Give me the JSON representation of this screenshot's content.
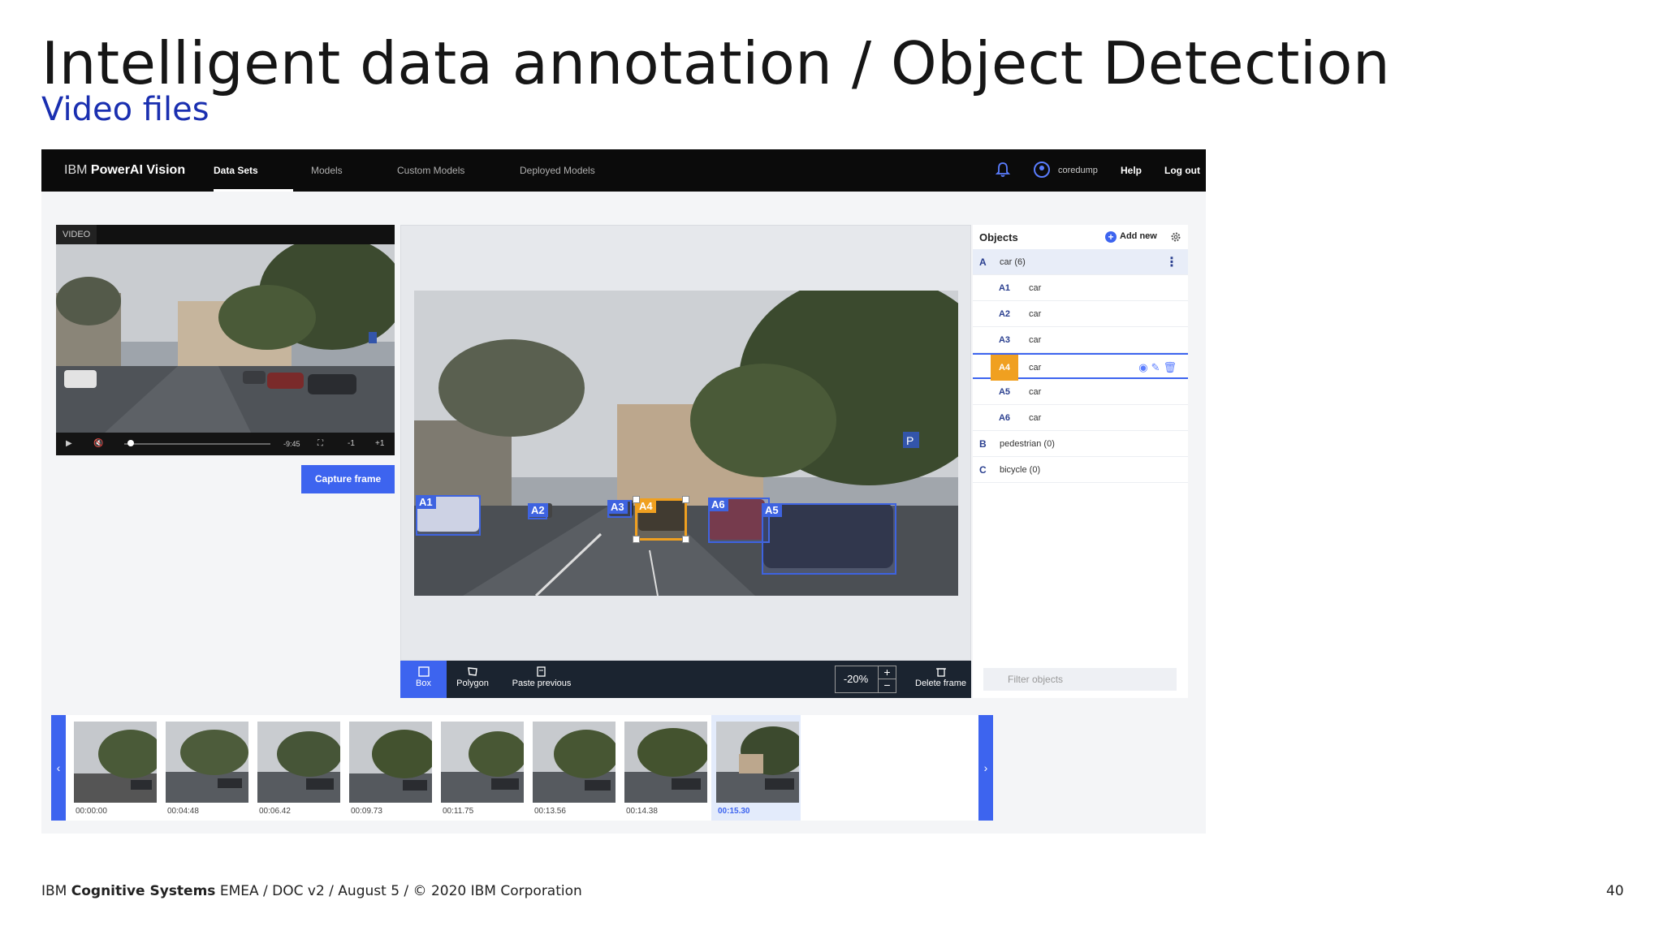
{
  "slide": {
    "title": "Intelligent data annotation / Object Detection",
    "subtitle": "Video files"
  },
  "nav": {
    "brand_prefix": "IBM",
    "brand_name": "PowerAI Vision",
    "tabs": [
      {
        "label": "Data Sets",
        "active": true
      },
      {
        "label": "Models",
        "active": false
      },
      {
        "label": "Custom Models",
        "active": false
      },
      {
        "label": "Deployed Models",
        "active": false
      }
    ],
    "username": "coredump",
    "help": "Help",
    "logout": "Log out"
  },
  "video": {
    "tag": "VIDEO",
    "time_remaining": "-9:45",
    "step_back": "-1",
    "step_fwd": "+1",
    "playback_progress": 0.02,
    "capture_label": "Capture frame"
  },
  "canvas": {
    "boxes": [
      {
        "label": "A1",
        "selected": false
      },
      {
        "label": "A2",
        "selected": false
      },
      {
        "label": "A3",
        "selected": false
      },
      {
        "label": "A4",
        "selected": true
      },
      {
        "label": "A6",
        "selected": false
      },
      {
        "label": "A5",
        "selected": false
      }
    ]
  },
  "toolbar": {
    "box": "Box",
    "polygon": "Polygon",
    "paste_previous": "Paste previous",
    "zoom": "-20%",
    "zoom_plus": "+",
    "zoom_minus": "−",
    "delete_frame": "Delete frame"
  },
  "objects": {
    "title": "Objects",
    "add_new": "Add new",
    "groups": [
      {
        "letter": "A",
        "name": "car (6)"
      },
      {
        "letter": "B",
        "name": "pedestrian (0)"
      },
      {
        "letter": "C",
        "name": "bicycle (0)"
      }
    ],
    "items": [
      {
        "code": "A1",
        "name": "car",
        "selected": false
      },
      {
        "code": "A2",
        "name": "car",
        "selected": false
      },
      {
        "code": "A3",
        "name": "car",
        "selected": false
      },
      {
        "code": "A4",
        "name": "car",
        "selected": true
      },
      {
        "code": "A5",
        "name": "car",
        "selected": false
      },
      {
        "code": "A6",
        "name": "car",
        "selected": false
      }
    ],
    "filter_placeholder": "Filter objects"
  },
  "filmstrip": {
    "frames": [
      {
        "time": "00:00:00",
        "current": false
      },
      {
        "time": "00:04:48",
        "current": false
      },
      {
        "time": "00:06.42",
        "current": false
      },
      {
        "time": "00:09.73",
        "current": false
      },
      {
        "time": "00:11.75",
        "current": false
      },
      {
        "time": "00:13.56",
        "current": false
      },
      {
        "time": "00:14.38",
        "current": false
      },
      {
        "time": "00:15.30",
        "current": true
      }
    ]
  },
  "footer": {
    "prefix": "IBM",
    "bold": "Cognitive Systems",
    "rest": "EMEA / DOC v2 / August 5 / © 2020 IBM Corporation",
    "page": "40"
  },
  "colors": {
    "accent": "#3d64ef",
    "selected": "#f0a020",
    "nav_bg": "#0b0b0b",
    "subtitle": "#1a2fb0"
  }
}
